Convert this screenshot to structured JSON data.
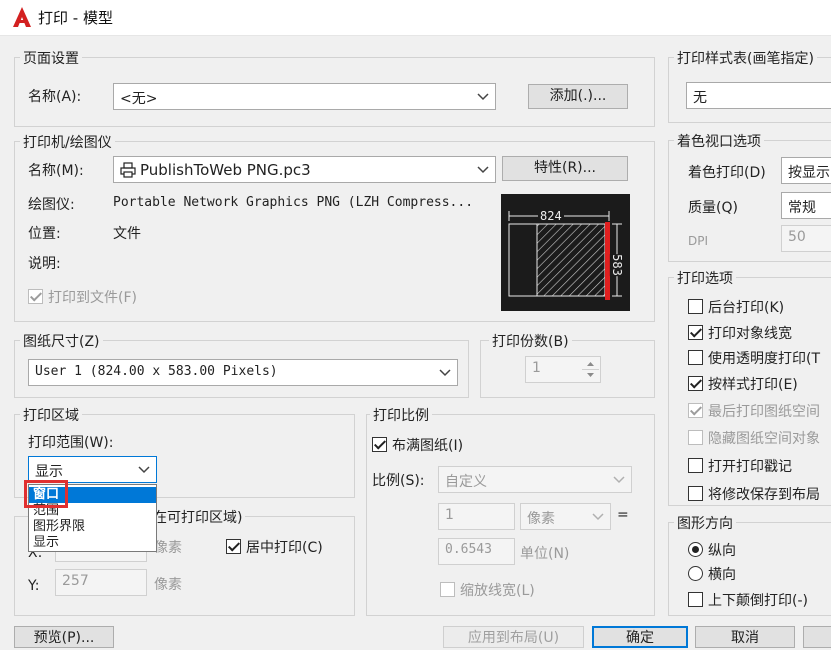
{
  "window": {
    "title": "打印 - 模型"
  },
  "page_setup": {
    "group_label": "页面设置",
    "name_label": "名称(A):",
    "name_value": "<无>",
    "add_button": "添加(.)..."
  },
  "printer": {
    "group_label": "打印机/绘图仪",
    "name_label": "名称(M):",
    "name_value": "PublishToWeb PNG.pc3",
    "properties_button": "特性(R)...",
    "plotter_label": "绘图仪:",
    "plotter_value": "Portable Network Graphics PNG (LZH Compress...",
    "location_label": "位置:",
    "location_value": "文件",
    "description_label": "说明:",
    "plot_to_file_label": "打印到文件(F)",
    "plot_to_file_checked": true,
    "preview_width": "824",
    "preview_height": "583"
  },
  "paper_size": {
    "group_label": "图纸尺寸(Z)",
    "value": "User 1 (824.00 x 583.00 Pixels)"
  },
  "copies": {
    "group_label": "打印份数(B)",
    "value": "1"
  },
  "plot_area": {
    "group_label": "打印区域",
    "range_label": "打印范围(W):",
    "range_value": "显示",
    "dropdown_options": [
      "窗口",
      "范围",
      "图形界限",
      "显示"
    ],
    "selected_option": "窗口"
  },
  "plot_offset": {
    "group_label_tail": "在可打印区域)",
    "x_label": "X:",
    "x_unit": "像素",
    "y_label": "Y:",
    "y_value": "257",
    "y_unit": "像素",
    "center_label": "居中打印(C)",
    "center_checked": true
  },
  "plot_scale": {
    "group_label": "打印比例",
    "fit_label": "布满图纸(I)",
    "fit_checked": true,
    "scale_label": "比例(S):",
    "scale_value": "自定义",
    "value1": "1",
    "unit1": "像素",
    "equals": "=",
    "value2": "0.6543",
    "unit2": "单位(N)",
    "lineweights_label": "缩放线宽(L)"
  },
  "plot_style_table": {
    "group_label": "打印样式表(画笔指定)",
    "value": "无"
  },
  "shaded_viewport": {
    "group_label": "着色视口选项",
    "shade_label": "着色打印(D)",
    "shade_value": "按显示",
    "quality_label": "质量(Q)",
    "quality_value": "常规",
    "dpi_label": "DPI",
    "dpi_value": "50"
  },
  "plot_options": {
    "group_label": "打印选项",
    "items": [
      {
        "label": "后台打印(K)",
        "checked": false,
        "disabled": false
      },
      {
        "label": "打印对象线宽",
        "checked": true,
        "disabled": false
      },
      {
        "label": "使用透明度打印(T",
        "checked": false,
        "disabled": false
      },
      {
        "label": "按样式打印(E)",
        "checked": true,
        "disabled": false
      },
      {
        "label": "最后打印图纸空间",
        "checked": true,
        "disabled": true
      },
      {
        "label": "隐藏图纸空间对象",
        "checked": false,
        "disabled": true
      },
      {
        "label": "打开打印戳记",
        "checked": false,
        "disabled": false
      },
      {
        "label": "将修改保存到布局",
        "checked": false,
        "disabled": false
      }
    ]
  },
  "orientation": {
    "group_label": "图形方向",
    "portrait_label": "纵向",
    "landscape_label": "横向",
    "upside_down_label": "上下颠倒打印(-)",
    "selected": "portrait"
  },
  "footer": {
    "preview_button": "预览(P)...",
    "apply_button": "应用到布局(U)",
    "ok_button": "确定",
    "cancel_button": "取消"
  },
  "colors": {
    "accent": "#0078d7",
    "highlight": "#e03030"
  }
}
